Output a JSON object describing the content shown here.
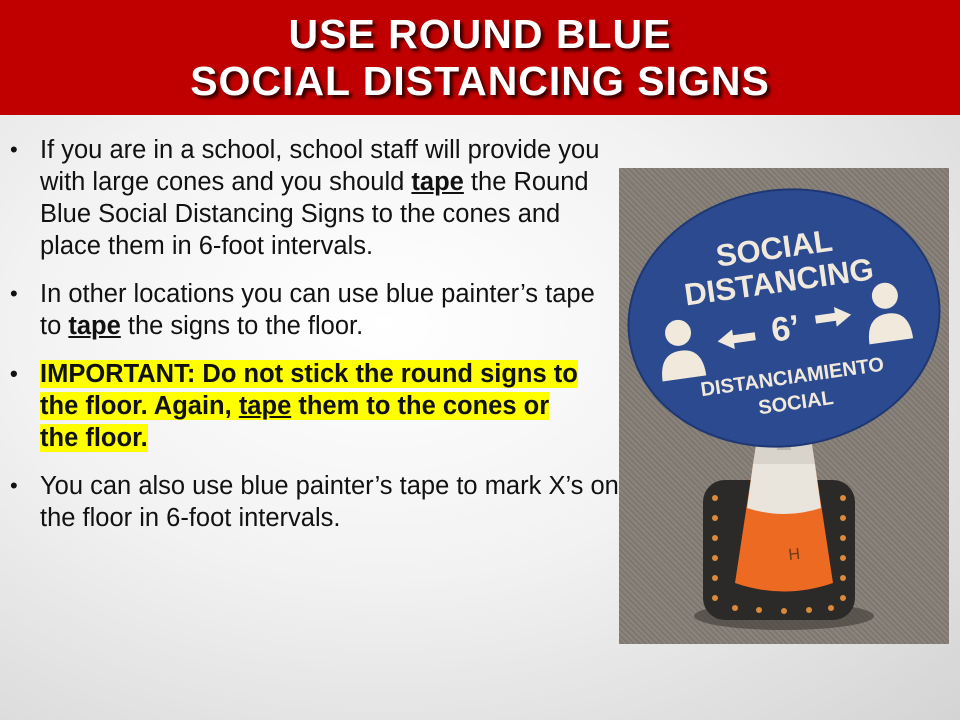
{
  "title": {
    "line1": "USE ROUND BLUE",
    "line2": "SOCIAL DISTANCING SIGNS"
  },
  "bullets": [
    {
      "part1": "If you are in a school, school staff will provide you with large cones and you should ",
      "emphasis": "tape",
      "part2": " the Round Blue Social Distancing Signs to the cones and place them in 6-foot intervals."
    },
    {
      "part1": "In other locations you can use blue painter’s tape to ",
      "emphasis": "tape",
      "part2": " the signs to the floor."
    },
    {
      "part1": "IMPORTANT:  Do not stick the round signs to the floor. Again, ",
      "emphasis": "tape",
      "part2": " them to the cones or the floor."
    },
    {
      "text": "You can also use blue painter’s tape to mark X’s on the floor in 6-foot intervals."
    }
  ],
  "photo": {
    "sign_line1": "SOCIAL",
    "sign_line2": "DISTANCING",
    "sign_distance": "6’",
    "sign_line3": "DISTANCIAMIENTO",
    "sign_line4": "SOCIAL",
    "cone_mark": "H"
  },
  "colors": {
    "title_bar": "#c00000",
    "highlight": "#ffff00",
    "sign_blue": "#2b4a8f",
    "cone_orange": "#ec6a22"
  }
}
